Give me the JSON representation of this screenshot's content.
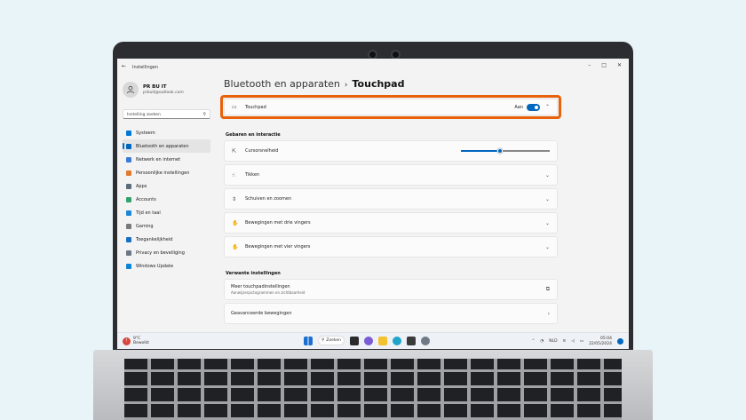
{
  "window": {
    "title": "Instellingen"
  },
  "profile": {
    "name": "PR BU IT",
    "email": "prbuit@outlook.com"
  },
  "search": {
    "placeholder": "Instelling zoeken"
  },
  "nav": [
    {
      "label": "Systeem",
      "icon": "monitor-icon",
      "color": "#0078d4"
    },
    {
      "label": "Bluetooth en apparaten",
      "icon": "bluetooth-icon",
      "color": "#0067c0",
      "active": true
    },
    {
      "label": "Netwerk en internet",
      "icon": "wifi-icon",
      "color": "#3a7bd5"
    },
    {
      "label": "Persoonlijke instellingen",
      "icon": "brush-icon",
      "color": "#e07a2e"
    },
    {
      "label": "Apps",
      "icon": "apps-icon",
      "color": "#5a6b7b"
    },
    {
      "label": "Accounts",
      "icon": "person-icon",
      "color": "#2fa36b"
    },
    {
      "label": "Tijd en taal",
      "icon": "clock-globe-icon",
      "color": "#1a86d6"
    },
    {
      "label": "Gaming",
      "icon": "gamepad-icon",
      "color": "#7a7a7a"
    },
    {
      "label": "Toegankelijkheid",
      "icon": "accessibility-icon",
      "color": "#1a6fc4"
    },
    {
      "label": "Privacy en beveiliging",
      "icon": "shield-icon",
      "color": "#6b7785"
    },
    {
      "label": "Windows Update",
      "icon": "update-icon",
      "color": "#0a84d6"
    }
  ],
  "header": {
    "parent": "Bluetooth en apparaten",
    "separator": "›",
    "current": "Touchpad"
  },
  "touchpad": {
    "label": "Touchpad",
    "state_label": "Aan",
    "on": true
  },
  "gestures": {
    "section_title": "Gebaren en interactie",
    "cursor_speed_label": "Cursorsnelheid",
    "cursor_speed_fraction": 0.44,
    "items": [
      "Tikken",
      "Schuiven en zoomen",
      "Bewegingen met drie vingers",
      "Bewegingen met vier vingers"
    ]
  },
  "related": {
    "section_title": "Verwante instellingen",
    "more_label": "Meer touchpadinstellingen",
    "more_sub": "Aanwijzerpictogrammen en zichtbaarheid",
    "advanced_label": "Geavanceerde bewegingen"
  },
  "taskbar": {
    "temp": "9°C",
    "weather": "Bewolkt",
    "search_label": "Zoeken",
    "lang": "NLD",
    "time": "05:04",
    "date": "22/05/2024"
  },
  "colors": {
    "accent": "#0067c0",
    "highlight": "#e8620c"
  }
}
